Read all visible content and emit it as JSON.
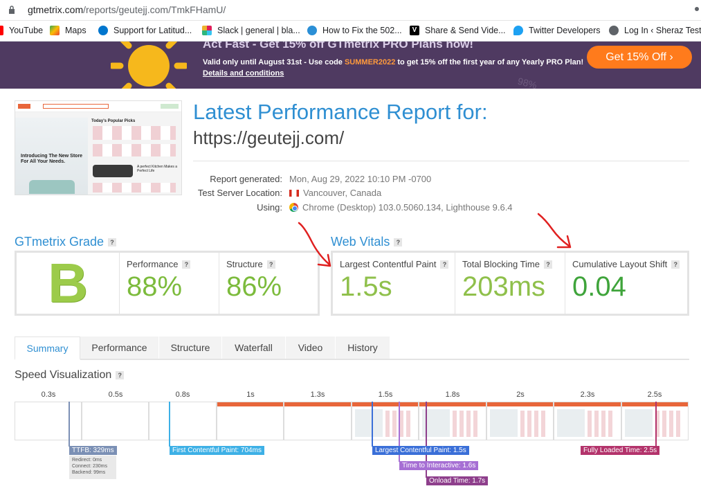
{
  "browser": {
    "url_host": "gtmetrix.com",
    "url_path": "/reports/geutejj.com/TmkFHamU/",
    "bookmarks": [
      {
        "label": "YouTube",
        "icon": "youtube-icon",
        "color": "#ff0000"
      },
      {
        "label": "Maps",
        "icon": "maps-icon",
        "color": "#34a853"
      },
      {
        "label": "Support for Latitud...",
        "icon": "dell-icon",
        "color": "#0076ce"
      },
      {
        "label": "Slack | general | bla...",
        "icon": "slack-icon",
        "color": "#e01e5a"
      },
      {
        "label": "How to Fix the 502...",
        "icon": "site-icon",
        "color": "#2b8fd6"
      },
      {
        "label": "Share & Send Vide...",
        "icon": "vimeo-v-icon",
        "color": "#000000"
      },
      {
        "label": "Twitter Developers",
        "icon": "twitter-icon",
        "color": "#1da1f2"
      },
      {
        "label": "Log In ‹ Sheraz Test...",
        "icon": "globe-icon",
        "color": "#5f6368"
      }
    ]
  },
  "banner": {
    "headline": "Act Fast - Get 15% off GTmetrix PRO Plans now!",
    "valid_prefix": "Valid only until August 31st - Use code ",
    "code": "SUMMER2022",
    "valid_suffix": " to get 15% off the first year of any Yearly PRO Plan!",
    "details": "Details and conditions",
    "cta": "Get 15% Off  ›",
    "ghost": "98%"
  },
  "report": {
    "title": "Latest Performance Report for:",
    "site": "https://geutejj.com/",
    "meta": {
      "generated_label": "Report generated:",
      "generated_value": "Mon, Aug 29, 2022 10:10 PM -0700",
      "location_label": "Test Server Location:",
      "location_value": "Vancouver, Canada",
      "using_label": "Using:",
      "using_value": "Chrome (Desktop) 103.0.5060.134, Lighthouse 9.6.4"
    }
  },
  "thumbnail": {
    "hero_text": "Introducing The New Store For All Your Needs.",
    "popular": "Today's Popular Picks",
    "kitchen": "A perfect Kitchen Makes a Perfect Life"
  },
  "grade": {
    "title": "GTmetrix Grade",
    "letter": "B",
    "performance_label": "Performance",
    "performance_value": "88%",
    "structure_label": "Structure",
    "structure_value": "86%"
  },
  "web_vitals": {
    "title": "Web Vitals",
    "lcp_label": "Largest Contentful Paint",
    "lcp_value": "1.5s",
    "tbt_label": "Total Blocking Time",
    "tbt_value": "203ms",
    "cls_label": "Cumulative Layout Shift",
    "cls_value": "0.04"
  },
  "tabs": [
    {
      "label": "Summary",
      "active": true
    },
    {
      "label": "Performance",
      "active": false
    },
    {
      "label": "Structure",
      "active": false
    },
    {
      "label": "Waterfall",
      "active": false
    },
    {
      "label": "Video",
      "active": false
    },
    {
      "label": "History",
      "active": false
    }
  ],
  "speed": {
    "title": "Speed Visualization",
    "ticks": [
      "0.3s",
      "0.5s",
      "0.8s",
      "1s",
      "1.3s",
      "1.5s",
      "1.8s",
      "2s",
      "2.3s",
      "2.5s"
    ],
    "markers": {
      "ttfb": "TTFB: 329ms",
      "redirect": "Redirect: 0ms",
      "connect": "Connect: 230ms",
      "backend": "Backend: 99ms",
      "fcp": "First Contentful Paint: 704ms",
      "lcp": "Largest Contentful Paint: 1.5s",
      "tti": "Time to Interactive: 1.6s",
      "onload": "Onload Time: 1.7s",
      "fully": "Fully Loaded Time: 2.5s"
    }
  },
  "colors": {
    "accent": "#2f8fd2",
    "good_green": "#7cbb3c",
    "grade_green": "#9ccb4a",
    "banner_bg": "#4f3a61",
    "cta_orange": "#ff7b1c",
    "annotation_red": "#e02020"
  }
}
